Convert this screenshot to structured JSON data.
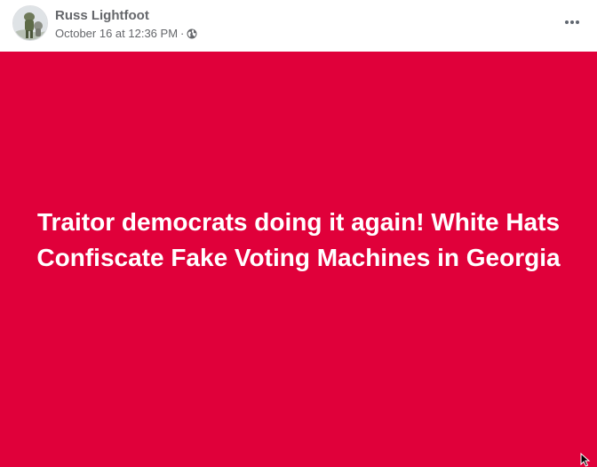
{
  "post": {
    "author": "Russ Lightfoot",
    "timestamp": "October 16 at 12:36 PM",
    "separator": "·",
    "privacy_icon": "globe-icon",
    "menu_icon": "more-options-icon",
    "text": "Traitor democrats doing it again! White Hats Confiscate Fake Voting Machines in Georgia",
    "background_color": "#e0003a",
    "text_color": "#ffffff"
  }
}
